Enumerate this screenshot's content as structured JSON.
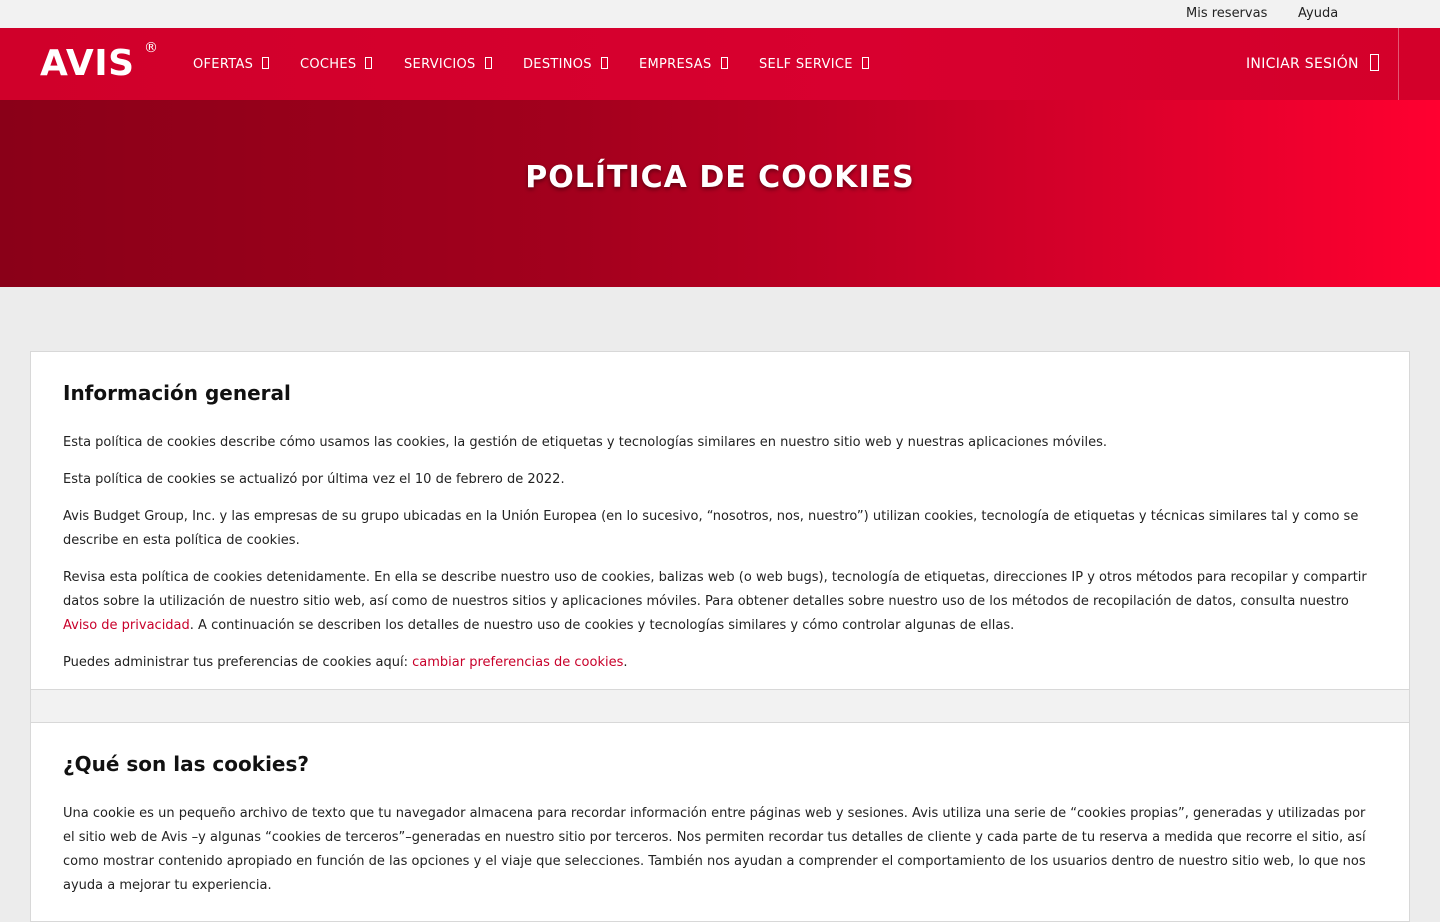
{
  "utility": {
    "reservas": "Mis reservas",
    "ayuda": "Ayuda"
  },
  "brand": {
    "logo": "AVIS",
    "registered": "®"
  },
  "nav": {
    "items": [
      {
        "label": "OFERTAS"
      },
      {
        "label": "COCHES"
      },
      {
        "label": "SERVICIOS"
      },
      {
        "label": "DESTINOS"
      },
      {
        "label": "EMPRESAS"
      },
      {
        "label": "SELF SERVICE"
      }
    ],
    "login": "INICIAR SESIÓN"
  },
  "hero": {
    "title": "POLÍTICA DE COOKIES"
  },
  "sections": [
    {
      "heading": "Información general",
      "p1": "Esta política de cookies describe cómo usamos las cookies, la gestión de etiquetas y tecnologías similares en nuestro sitio web y nuestras aplicaciones móviles.",
      "p2": "Esta política de cookies se actualizó por última vez el 10 de febrero de 2022.",
      "p3": "Avis Budget Group, Inc. y las empresas de su grupo ubicadas en la Unión Europea (en lo sucesivo, “nosotros, nos, nuestro”) utilizan cookies, tecnología de etiquetas y técnicas similares tal y como se describe en esta política de cookies.",
      "p4_before": "Revisa esta política de cookies detenidamente. En ella se describe nuestro uso de cookies, balizas web (o web bugs), tecnología de etiquetas, direcciones IP y otros métodos para recopilar y compartir datos sobre la utilización de nuestro sitio web, así como de nuestros sitios y aplicaciones móviles. Para obtener detalles sobre nuestro uso de los métodos de recopilación de datos, consulta nuestro ",
      "p4_link": "Aviso de privacidad",
      "p4_after": ". A continuación se describen los detalles de nuestro uso de cookies y tecnologías similares y cómo controlar algunas de ellas.",
      "p5_before": "Puedes administrar tus preferencias de cookies aquí: ",
      "p5_link": "cambiar preferencias de cookies",
      "p5_after": "."
    },
    {
      "heading": "¿Qué son las cookies?",
      "p1": "Una cookie es un pequeño archivo de texto que tu navegador almacena para recordar información entre páginas web y sesiones. Avis utiliza una serie de “cookies propias”, generadas y utilizadas por el sitio web de Avis –y algunas “cookies de terceros”–generadas en nuestro sitio por terceros. Nos permiten recordar tus detalles de cliente y cada parte de tu reserva a medida que recorre el sitio, así como mostrar contenido apropiado en función de las opciones y el viaje que selecciones. También nos ayudan a comprender el comportamiento de los usuarios dentro de nuestro sitio web, lo que nos ayuda a mejorar tu experiencia."
    }
  ]
}
